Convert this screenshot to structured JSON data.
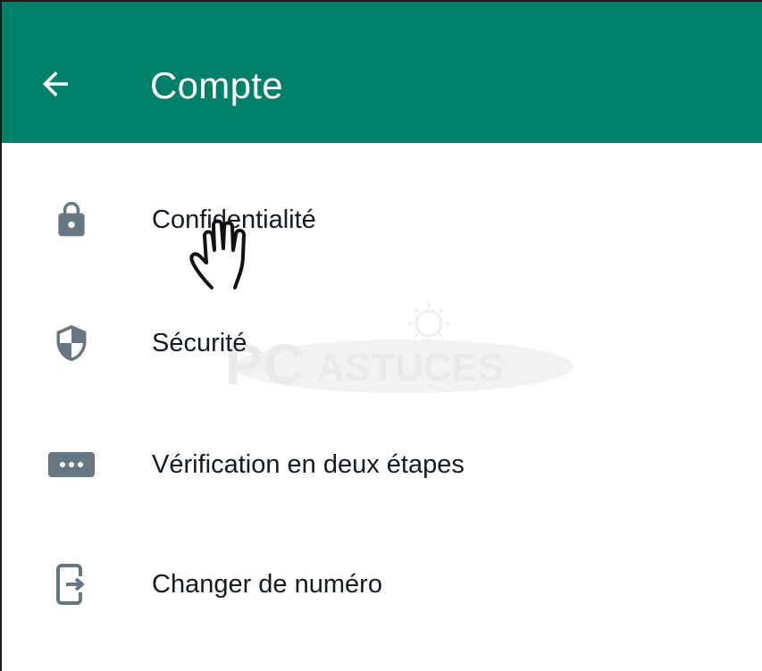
{
  "header": {
    "title": "Compte",
    "background_color": "#008069",
    "back_icon": "arrow-left-icon"
  },
  "menu": {
    "items": [
      {
        "label": "Confidentialité",
        "icon": "lock-icon"
      },
      {
        "label": "Sécurité",
        "icon": "shield-icon"
      },
      {
        "label": "Vérification en deux étapes",
        "icon": "dots-password-icon"
      },
      {
        "label": "Changer de numéro",
        "icon": "change-number-icon"
      }
    ],
    "icon_color": "#667781",
    "text_color": "#111b21"
  },
  "watermark": {
    "text": "PCASTUCES",
    "logo": "pc-astuces-watermark"
  },
  "cursor": {
    "icon": "hand-pointer-icon"
  }
}
